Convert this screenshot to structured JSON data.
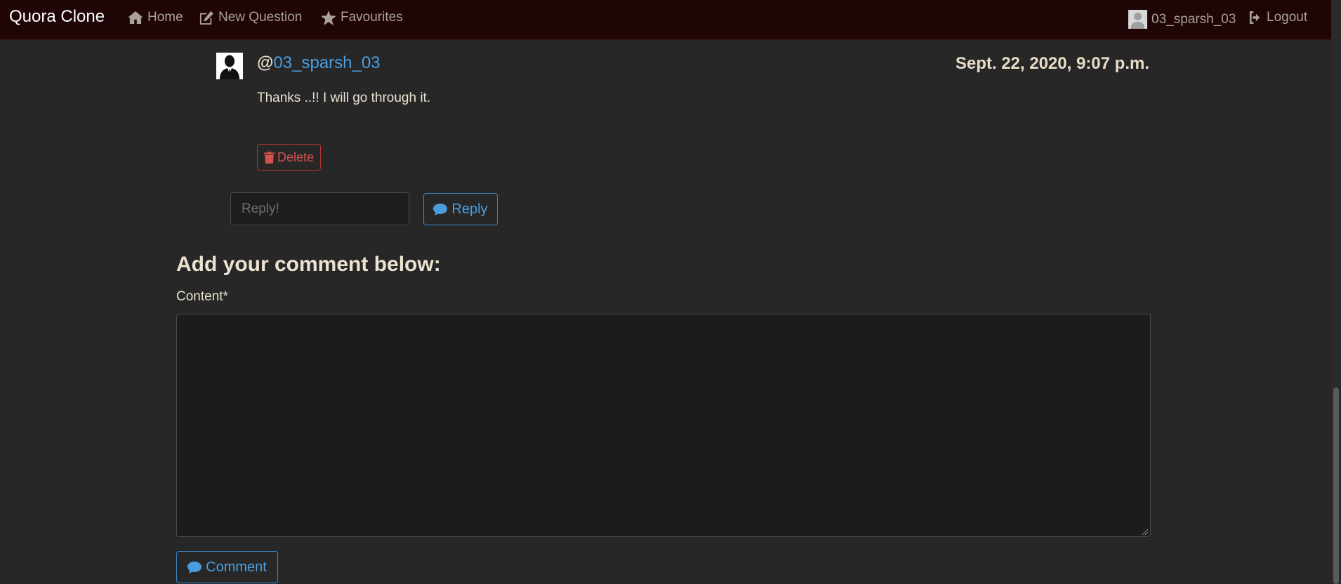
{
  "navbar": {
    "brand": "Quora Clone",
    "links": [
      {
        "label": "Home",
        "icon": "home-icon"
      },
      {
        "label": "New Question",
        "icon": "edit-icon"
      },
      {
        "label": "Favourites",
        "icon": "star-icon"
      }
    ],
    "user": {
      "username": "03_sparsh_03",
      "icon": "avatar"
    },
    "logout": {
      "label": "Logout",
      "icon": "logout-icon"
    }
  },
  "reply": {
    "at": "@",
    "username": "03_sparsh_03",
    "date": "Sept. 22, 2020, 9:07 p.m.",
    "text": "Thanks ..!! I will go through it.",
    "delete_label": "Delete"
  },
  "reply_form": {
    "placeholder": "Reply!",
    "button_label": "Reply"
  },
  "comment_form": {
    "title": "Add your comment below:",
    "content_label": "Content*",
    "button_label": "Comment"
  },
  "colors": {
    "navbar_bg": "#1f0505",
    "page_bg": "#272727",
    "accent_blue": "#4a9ee0",
    "danger_red": "#d65050"
  }
}
